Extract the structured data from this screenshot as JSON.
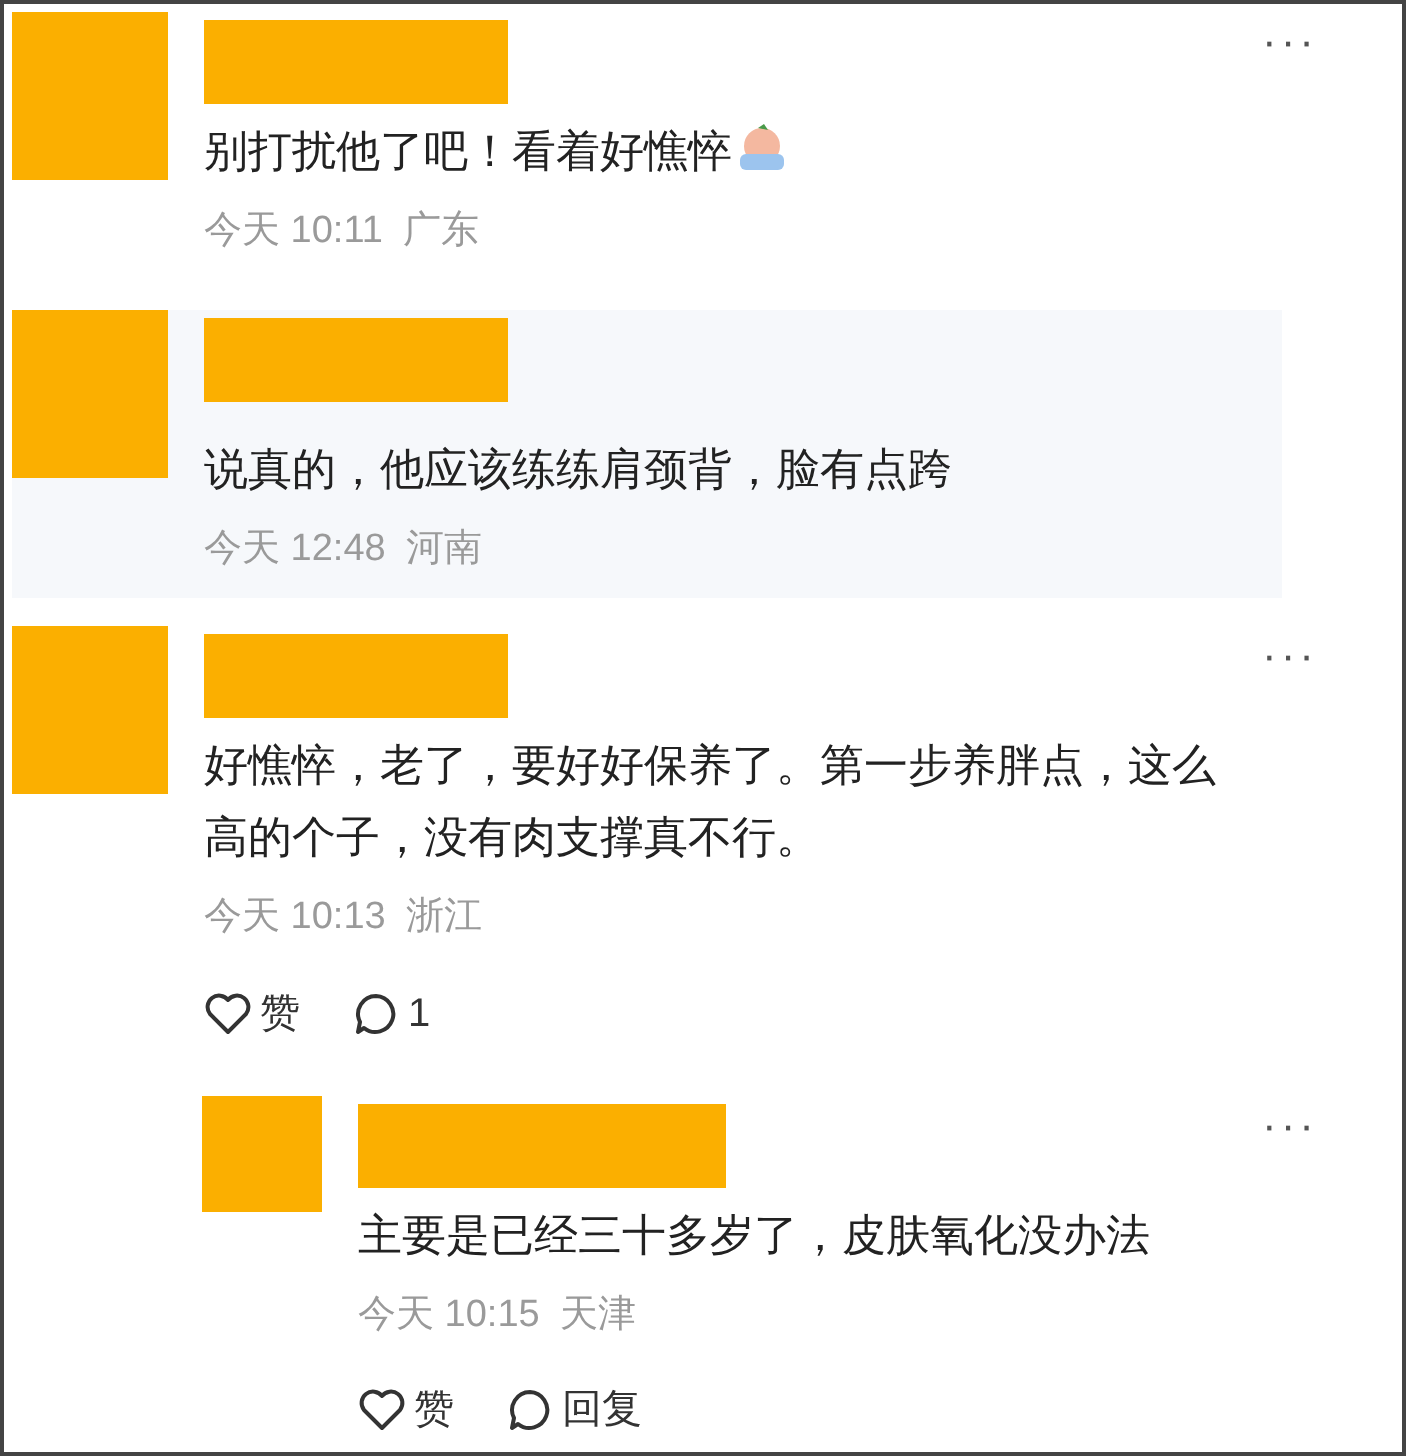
{
  "comments": [
    {
      "text": "别打扰他了吧！看着好憔悴",
      "emoji": true,
      "time": "今天 10:11",
      "location": "广东",
      "highlighted": false,
      "menu": "···"
    },
    {
      "text": "说真的，他应该练练肩颈背，脸有点跨",
      "emoji": false,
      "time": "今天 12:48",
      "location": "河南",
      "highlighted": true
    },
    {
      "text": "好憔悴，老了，要好好保养了。第一步养胖点，这么高的个子，没有肉支撑真不行。",
      "emoji": false,
      "time": "今天 10:13",
      "location": "浙江",
      "highlighted": false,
      "menu": "···",
      "like": "赞",
      "reply": "1",
      "children": [
        {
          "text": "主要是已经三十多岁了，皮肤氧化没办法",
          "emoji": false,
          "time": "今天 10:15",
          "location": "天津",
          "highlighted": false,
          "menu": "···",
          "like": "赞",
          "reply": "回复"
        }
      ]
    }
  ]
}
